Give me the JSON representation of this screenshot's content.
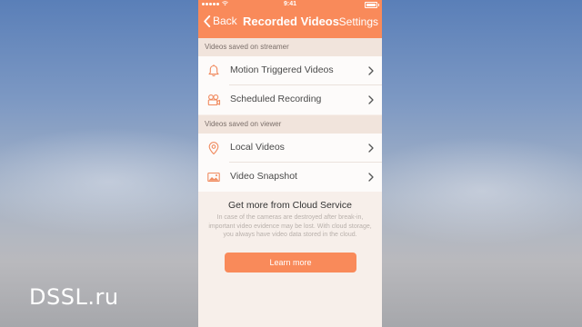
{
  "background": {
    "watermark": "DSSL.ru"
  },
  "colors": {
    "accent": "#f98a5a",
    "section_bg": "#f1e4dc",
    "row_bg": "#fdfbfa",
    "icon": "#f08a5e"
  },
  "status_bar": {
    "time": "9:41",
    "battery_level": 1.0
  },
  "nav": {
    "back_label": "Back",
    "title": "Recorded Videos",
    "settings_label": "Settings"
  },
  "sections": [
    {
      "header": "Videos saved on streamer",
      "items": [
        {
          "label": "Motion Triggered Videos",
          "icon": "bell-icon"
        },
        {
          "label": "Scheduled Recording",
          "icon": "film-camera-icon"
        }
      ]
    },
    {
      "header": "Videos saved on viewer",
      "items": [
        {
          "label": "Local Videos",
          "icon": "location-pin-icon"
        },
        {
          "label": "Video Snapshot",
          "icon": "image-icon"
        }
      ]
    }
  ],
  "cloud": {
    "title": "Get more from Cloud Service",
    "description": "In case of the cameras are destroyed after break-in, important video evidence may be lost. With cloud storage, you always have video data stored in the cloud.",
    "button_label": "Learn more"
  }
}
